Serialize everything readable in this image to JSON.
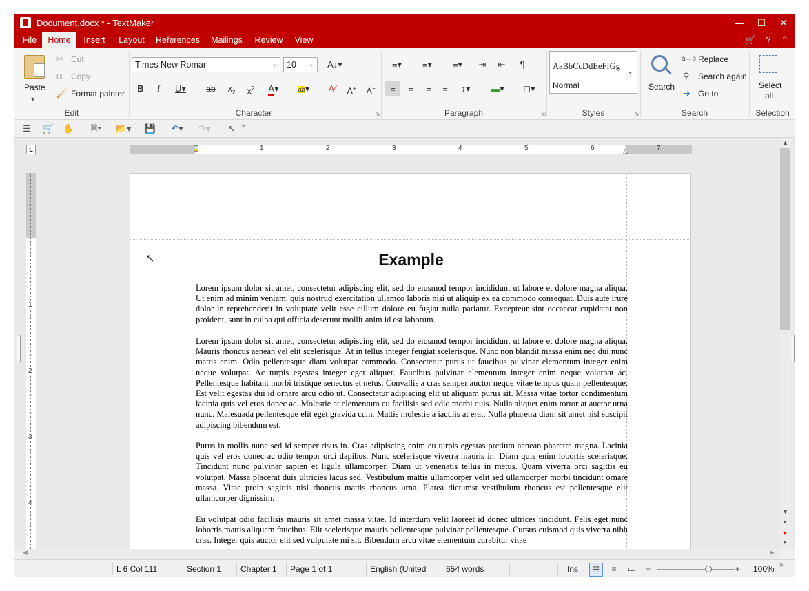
{
  "window": {
    "title": "Document.docx * - TextMaker"
  },
  "menubar": {
    "tabs": [
      "File",
      "Home",
      "Insert",
      "Layout",
      "References",
      "Mailings",
      "Review",
      "View"
    ],
    "active": "Home"
  },
  "ribbon": {
    "edit": {
      "paste": "Paste",
      "cut": "Cut",
      "copy": "Copy",
      "format_painter": "Format painter",
      "label": "Edit"
    },
    "character": {
      "font": "Times New Roman",
      "size": "10",
      "label": "Character"
    },
    "paragraph": {
      "label": "Paragraph"
    },
    "styles": {
      "preview": "AaBbCcDdEeFfGg",
      "current": "Normal",
      "label": "Styles"
    },
    "search": {
      "search": "Search",
      "replace": "Replace",
      "search_again": "Search again",
      "go_to": "Go to",
      "label": "Search"
    },
    "selection": {
      "select_all_1": "Select",
      "select_all_2": "all",
      "label": "Selection"
    }
  },
  "ruler": {
    "h_numbers": [
      "1",
      "2",
      "3",
      "4",
      "5",
      "6",
      "7"
    ],
    "v_numbers": [
      "1",
      "2",
      "3",
      "4"
    ],
    "tab_button": "L"
  },
  "document": {
    "heading": "Example",
    "paragraphs": [
      "Lorem ipsum dolor sit amet, consectetur adipiscing elit, sed do eiusmod tempor incididunt ut labore et dolore magna aliqua. Ut enim ad minim veniam, quis nostrud exercitation ullamco laboris nisi ut aliquip ex ea commodo consequat. Duis aute irure dolor in reprehenderit in voluptate velit esse cillum dolore eu fugiat nulla pariatur. Excepteur sint occaecat cupidatat non proident, sunt in culpa qui officia deserunt mollit anim id est laborum.",
      "Lorem ipsum dolor sit amet, consectetur adipiscing elit, sed do eiusmod tempor incididunt ut labore et dolore magna aliqua. Mauris rhoncus aenean vel elit scelerisque. At in tellus integer feugiat scelerisque. Nunc non blandit massa enim nec dui nunc mattis enim. Odio pellentesque diam volutpat commodo. Consectetur purus ut faucibus pulvinar elementum integer enim neque volutpat. Ac turpis egestas integer eget aliquet. Faucibus pulvinar elementum integer enim neque volutpat ac. Pellentesque habitant morbi tristique senectus et netus. Convallis a cras semper auctor neque vitae tempus quam pellentesque. Est velit egestas dui id ornare arcu odio ut. Consectetur adipiscing elit ut aliquam purus sit. Massa vitae tortor condimentum lacinia quis vel eros donec ac. Molestie at elementum eu facilisis sed odio morbi quis. Nulla aliquet enim tortor at auctor urna nunc. Malesuada pellentesque elit eget gravida cum. Mattis molestie a iaculis at erat. Nulla pharetra diam sit amet nisl suscipit adipiscing bibendum est.",
      "Purus in mollis nunc sed id semper risus in. Cras adipiscing enim eu turpis egestas pretium aenean pharetra magna. Lacinia quis vel eros donec ac odio tempor orci dapibus. Nunc scelerisque viverra mauris in. Diam quis enim lobortis scelerisque. Tincidunt nunc pulvinar sapien et ligula ullamcorper. Diam ut venenatis tellus in metus. Quam viverra orci sagittis eu volutpat. Massa placerat duis ultricies lacus sed. Vestibulum mattis ullamcorper velit sed ullamcorper morbi tincidunt ornare massa. Vitae proin sagittis nisl rhoncus mattis rhoncus urna. Platea dictumst vestibulum rhoncus est pellentesque elit ullamcorper dignissim.",
      "Eu volutpat odio facilisis mauris sit amet massa vitae. Id interdum velit laoreet id donec ultrices tincidunt. Felis eget nunc lobortis mattis aliquam faucibus. Elit scelerisque mauris pellentesque pulvinar pellentesque. Cursus euismod quis viverra nibh cras. Integer quis auctor elit sed vulputate mi sit. Bibendum arcu vitae elementum curabitur vitae"
    ]
  },
  "status": {
    "position": "L 6 Col 111",
    "section": "Section 1",
    "chapter": "Chapter 1",
    "page": "Page 1 of 1",
    "language": "English (United",
    "words": "654 words",
    "mode": "Ins",
    "zoom": "100%",
    "zoom_level": 1.0
  },
  "colors": {
    "accent": "#c00000"
  }
}
